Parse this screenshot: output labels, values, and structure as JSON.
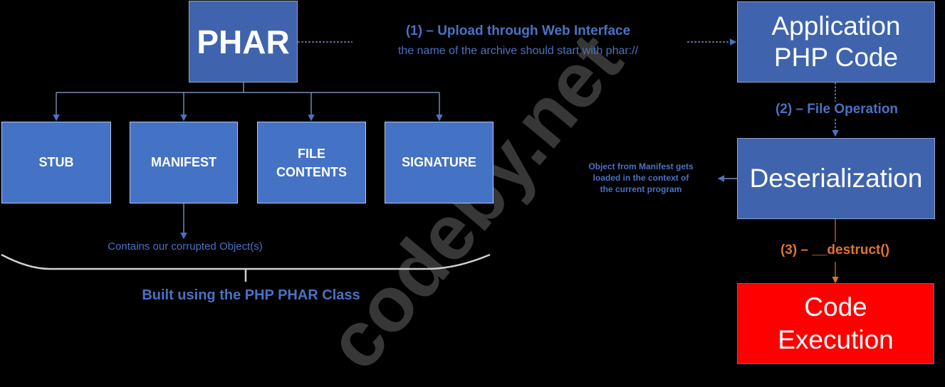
{
  "phar": {
    "title": "PHAR"
  },
  "components": [
    {
      "label": "STUB"
    },
    {
      "label": "MANIFEST"
    },
    {
      "label": "FILE CONTENTS"
    },
    {
      "label": "SIGNATURE"
    }
  ],
  "step1": {
    "title": "(1) – Upload through Web Interface",
    "subtitle": "the name of the archive should start with phar://"
  },
  "app_code": {
    "line1": "Application",
    "line2": "PHP Code"
  },
  "step2": {
    "label": "(2) – File Operation"
  },
  "deserialization": {
    "label": "Deserialization"
  },
  "deserialization_note": {
    "line1": "Object from Manifest gets",
    "line2": "loaded in the context of",
    "line3": "the current program"
  },
  "step3": {
    "label": "(3) – __destruct()"
  },
  "code_exec": {
    "line1": "Code",
    "line2": "Execution"
  },
  "manifest_note": {
    "label": "Contains our corrupted Object(s)"
  },
  "built_using": {
    "label": "Built using the PHP PHAR Class"
  },
  "watermark": {
    "text": "codeby.net"
  },
  "colors": {
    "box_blue": "#4472c4",
    "text_blue": "#4a72c4",
    "orange": "#e0742e",
    "red": "#ff0000"
  }
}
